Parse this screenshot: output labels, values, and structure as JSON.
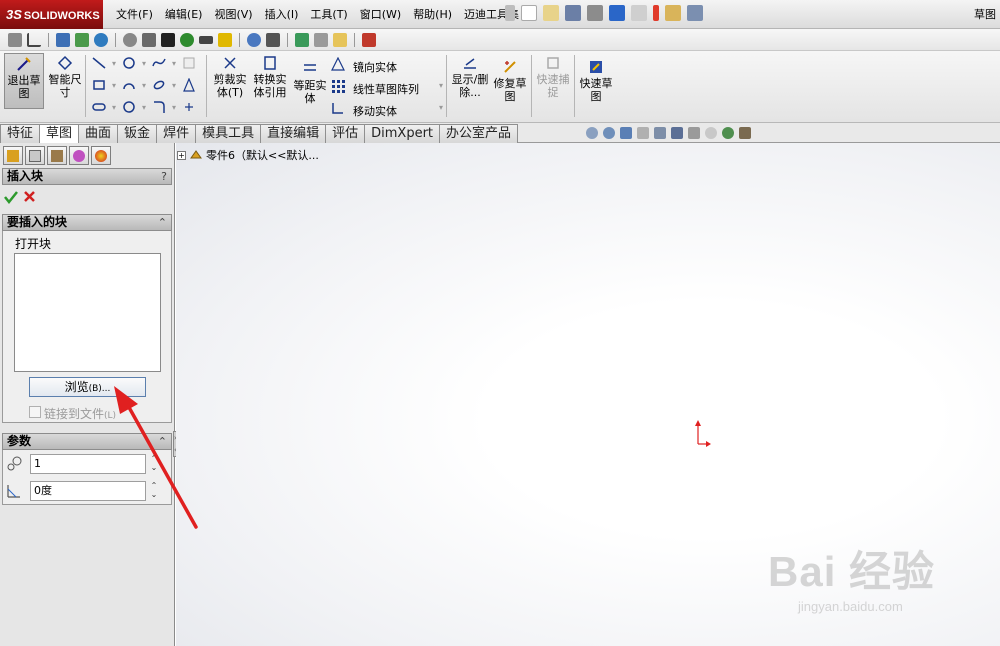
{
  "app": {
    "logo_prefix": "3S",
    "logo_text": "SOLIDWORKS",
    "window_title_fragment": "草图"
  },
  "menu": [
    "文件(F)",
    "编辑(E)",
    "视图(V)",
    "插入(I)",
    "工具(T)",
    "窗口(W)",
    "帮助(H)",
    "迈迪工具集"
  ],
  "ribbon": {
    "exit_sketch": "退出草图",
    "smart_dim": "智能尺寸",
    "trim": "剪裁实体(T)",
    "convert": "转换实体引用",
    "offset": "等距实体",
    "mirror": "镜向实体",
    "linear_pattern": "线性草图阵列",
    "move": "移动实体",
    "show_delete": "显示/删除...",
    "repair": "修复草图",
    "quick_snap": "快速捕捉",
    "rapid_sketch": "快速草图"
  },
  "tabs": [
    "特征",
    "草图",
    "曲面",
    "钣金",
    "焊件",
    "模具工具",
    "直接编辑",
    "评估",
    "DimXpert",
    "办公室产品"
  ],
  "active_tab": "草图",
  "panel": {
    "title": "插入块",
    "help": "?",
    "section1": {
      "title": "要插入的块",
      "open_block": "打开块",
      "browse": "浏览",
      "browse_shortcut": "(B)...",
      "link_to_file": "链接到文件",
      "link_shortcut": "(L)"
    },
    "section2": {
      "title": "参数",
      "scale_value": "1",
      "angle_value": "0度"
    }
  },
  "tree": {
    "part_label": "零件6（默认<<默认..."
  },
  "watermark": {
    "main": "Bai 经验",
    "sub": "jingyan.baidu.com"
  },
  "colors": {
    "accent_red": "#e02020",
    "check_green": "#2d9a2d"
  }
}
